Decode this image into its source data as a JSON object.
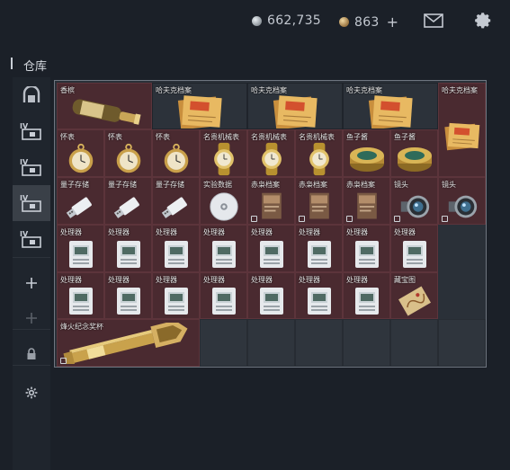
{
  "header": {
    "silver_amount": "662,735",
    "gold_amount": "863",
    "plus_label": "+",
    "mail_icon": "mail-icon",
    "settings_icon": "gear-icon"
  },
  "warehouse": {
    "title": "仓库"
  },
  "sidebar": {
    "items": [
      {
        "icon": "safe-icon",
        "active": false
      },
      {
        "icon": "case-iv-icon",
        "active": false
      },
      {
        "icon": "case-iv-icon",
        "active": false
      },
      {
        "icon": "case-iv-icon",
        "active": true
      },
      {
        "icon": "case-iv-icon",
        "active": false
      },
      {
        "icon": "plus-icon",
        "active": false
      },
      {
        "icon": "plus-icon-dim",
        "active": false
      },
      {
        "icon": "lock-icon",
        "active": false
      },
      {
        "icon": "gear-icon",
        "active": false
      }
    ]
  },
  "inventory": {
    "items": [
      {
        "label": "香槟",
        "icon": "champagne-icon",
        "bg": "red"
      },
      {
        "label": "哈夫克档案",
        "icon": "folder-icon",
        "bg": "neutral"
      },
      {
        "label": "哈夫克档案",
        "icon": "folder-icon",
        "bg": "neutral"
      },
      {
        "label": "哈夫克档案",
        "icon": "folder-icon",
        "bg": "neutral"
      },
      {
        "label": "哈夫克档案",
        "icon": "folder-icon",
        "bg": "red"
      },
      {
        "label": "怀表",
        "icon": "pocket-watch-icon",
        "bg": "red"
      },
      {
        "label": "怀表",
        "icon": "pocket-watch-icon",
        "bg": "red"
      },
      {
        "label": "怀表",
        "icon": "pocket-watch-icon",
        "bg": "red"
      },
      {
        "label": "名贵机械表",
        "icon": "wristwatch-icon",
        "bg": "red"
      },
      {
        "label": "名贵机械表",
        "icon": "wristwatch-icon",
        "bg": "red"
      },
      {
        "label": "名贵机械表",
        "icon": "wristwatch-icon",
        "bg": "red"
      },
      {
        "label": "鱼子酱",
        "icon": "caviar-tin-icon",
        "bg": "red"
      },
      {
        "label": "鱼子酱",
        "icon": "caviar-tin-icon",
        "bg": "red"
      },
      {
        "label": "量子存储",
        "icon": "usb-drive-icon",
        "bg": "red"
      },
      {
        "label": "量子存储",
        "icon": "usb-drive-icon",
        "bg": "red"
      },
      {
        "label": "量子存储",
        "icon": "usb-drive-icon",
        "bg": "red"
      },
      {
        "label": "实验数据",
        "icon": "disc-icon",
        "bg": "red"
      },
      {
        "label": "赤枭档案",
        "icon": "file-icon",
        "bg": "red"
      },
      {
        "label": "赤枭档案",
        "icon": "file-icon",
        "bg": "red"
      },
      {
        "label": "赤枭档案",
        "icon": "file-icon",
        "bg": "red"
      },
      {
        "label": "镜头",
        "icon": "lens-icon",
        "bg": "red"
      },
      {
        "label": "镜头",
        "icon": "lens-icon",
        "bg": "red"
      },
      {
        "label": "处理器",
        "icon": "processor-icon",
        "bg": "red"
      },
      {
        "label": "处理器",
        "icon": "processor-icon",
        "bg": "red"
      },
      {
        "label": "处理器",
        "icon": "processor-icon",
        "bg": "red"
      },
      {
        "label": "处理器",
        "icon": "processor-icon",
        "bg": "red"
      },
      {
        "label": "处理器",
        "icon": "processor-icon",
        "bg": "red"
      },
      {
        "label": "处理器",
        "icon": "processor-icon",
        "bg": "red"
      },
      {
        "label": "处理器",
        "icon": "processor-icon",
        "bg": "red"
      },
      {
        "label": "处理器",
        "icon": "processor-icon",
        "bg": "red"
      },
      {
        "label": "处理器",
        "icon": "processor-icon",
        "bg": "red"
      },
      {
        "label": "处理器",
        "icon": "processor-icon",
        "bg": "red"
      },
      {
        "label": "处理器",
        "icon": "processor-icon",
        "bg": "red"
      },
      {
        "label": "处理器",
        "icon": "processor-icon",
        "bg": "red"
      },
      {
        "label": "处理器",
        "icon": "processor-icon",
        "bg": "red"
      },
      {
        "label": "处理器",
        "icon": "processor-icon",
        "bg": "red"
      },
      {
        "label": "处理器",
        "icon": "processor-icon",
        "bg": "red"
      },
      {
        "label": "藏宝图",
        "icon": "treasure-map-icon",
        "bg": "red"
      },
      {
        "label": "烽火纪念奖杯",
        "icon": "trophy-icon",
        "bg": "red"
      }
    ]
  }
}
